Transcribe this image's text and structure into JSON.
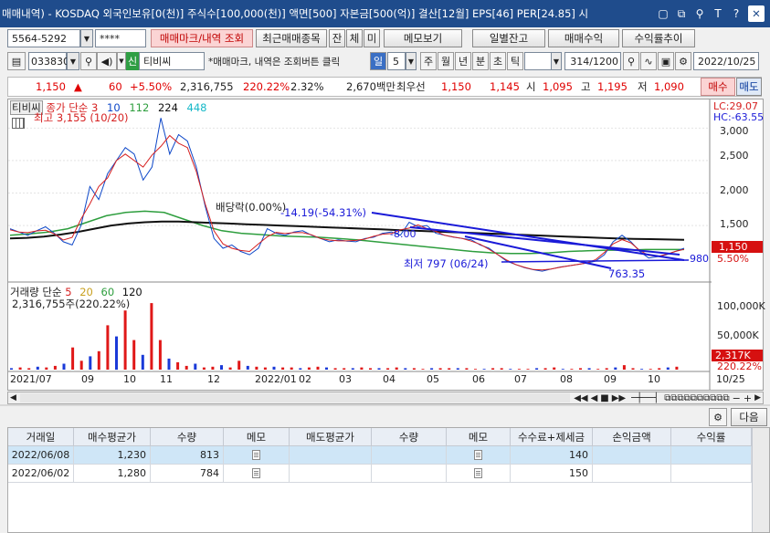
{
  "title": "매매내역) - KOSDAQ 외국인보유[0(천)] 주식수[100,000(천)] 액면[500] 자본금[500(억)] 결산[12월] EPS[46] PER[24.85] 시",
  "title_icons": [
    "▢",
    "⧉",
    "⚲",
    "T",
    "?"
  ],
  "close_label": "✕",
  "account": {
    "number": "5564-5292",
    "password": "****"
  },
  "toolbar1": {
    "memo_trades": "매매마크/내역 조회",
    "recent_items": "최근매매종목",
    "small_buttons": [
      "잔",
      "체",
      "미"
    ],
    "memo_view": "메모보기",
    "daily_balance": "일별잔고",
    "trade_return": "매매수익",
    "return_trend": "수익률추이"
  },
  "toolbar2": {
    "code": "033830",
    "sin_badge": "신",
    "stock_name": "티비씨",
    "hint": "*매매마크, 내역은 조회버튼 클릭",
    "period_label": "일",
    "period_value": "5",
    "periods": [
      "주",
      "월",
      "년",
      "분",
      "초",
      "틱"
    ],
    "count": "314",
    "count_total": "/1200",
    "date": "2022/10/25"
  },
  "quote": {
    "price": "1,150",
    "arrow": "▲",
    "change": "60",
    "change_pct": "+5.50%",
    "volume": "2,316,755",
    "volume_ratio": "220.22%",
    "turnover": "2.32%",
    "amount": "2,670백만",
    "best_ask_label": "최우선",
    "best_ask": "1,150",
    "best_bid": "1,145",
    "open_label": "시",
    "open": "1,095",
    "high_label": "고",
    "high": "1,195",
    "low_label": "저",
    "low": "1,090",
    "buy_label": "매수",
    "sell_label": "매도"
  },
  "chart_data": {
    "type": "line",
    "price_legend": {
      "name": "티비씨",
      "series_label": "종가 단순",
      "periods": [
        "3",
        "10",
        "112",
        "224",
        "448"
      ]
    },
    "annotations": {
      "high": "최고 3,155 (10/20)",
      "dividend": "배당락(0.00%)",
      "trend_pct": "-14.19(-54.31%)",
      "low": "최저 797 (06/24)",
      "trend_low": "763.35",
      "mid_value": "-8.00",
      "level_980": "980",
      "lc": "LC:29.07",
      "hc": "HC:-63.55"
    },
    "y_ticks": [
      "3,000",
      "2,500",
      "2,000",
      "1,500"
    ],
    "current_price": "1,150",
    "current_pct": "5.50%",
    "x_ticks": [
      "2021/07",
      "09",
      "10",
      "11",
      "12",
      "2022/01",
      "02",
      "03",
      "04",
      "05",
      "06",
      "07",
      "08",
      "09",
      "10",
      "10/25"
    ],
    "price": [
      1450,
      1400,
      1350,
      1420,
      1480,
      1380,
      1250,
      1200,
      1500,
      2100,
      1900,
      2300,
      2500,
      2700,
      2600,
      2200,
      2400,
      3155,
      2600,
      2900,
      2800,
      2400,
      1800,
      1300,
      1150,
      1200,
      1100,
      1050,
      1150,
      1450,
      1380,
      1350,
      1400,
      1420,
      1350,
      1300,
      1250,
      1280,
      1260,
      1250,
      1300,
      1320,
      1380,
      1400,
      1350,
      1550,
      1480,
      1500,
      1380,
      1350,
      1320,
      1300,
      1280,
      1200,
      1150,
      1050,
      950,
      900,
      850,
      820,
      797,
      830,
      860,
      880,
      900,
      920,
      950,
      1050,
      1250,
      1350,
      1250,
      1100,
      1000,
      1020,
      1050,
      1100,
      1150
    ],
    "ma_long": [
      1300,
      1310,
      1330,
      1360,
      1400,
      1450,
      1500,
      1530,
      1550,
      1560,
      1560,
      1550,
      1540,
      1530,
      1520,
      1510,
      1500,
      1490,
      1480,
      1470,
      1460,
      1450,
      1440,
      1430,
      1420,
      1410,
      1400,
      1390,
      1380,
      1370,
      1360,
      1350,
      1340,
      1330,
      1320,
      1310,
      1300,
      1295,
      1290,
      1285,
      1280
    ],
    "ma_mid": [
      1350,
      1370,
      1400,
      1450,
      1550,
      1650,
      1700,
      1720,
      1700,
      1600,
      1500,
      1420,
      1380,
      1360,
      1340,
      1330,
      1320,
      1300,
      1280,
      1250,
      1220,
      1190,
      1160,
      1130,
      1100,
      1080,
      1070,
      1070,
      1080,
      1100,
      1110,
      1120,
      1120,
      1130,
      1130,
      1130
    ],
    "volume_legend": {
      "label": "거래량 단순",
      "periods": [
        "5",
        "20",
        "60",
        "120"
      ],
      "current": "2,316,755주(220.22%)"
    },
    "volume_ticks": [
      "100,000K",
      "50,000K"
    ],
    "volume_current": "2,317K",
    "volume_pct": "220.22%",
    "volume": [
      2,
      3,
      2,
      4,
      3,
      5,
      8,
      30,
      12,
      18,
      25,
      60,
      45,
      80,
      40,
      20,
      90,
      40,
      15,
      10,
      5,
      8,
      3,
      4,
      6,
      3,
      12,
      5,
      4,
      3,
      4,
      3,
      3,
      2,
      3,
      4,
      3,
      2,
      2,
      2,
      3,
      2,
      2,
      2,
      3,
      2,
      2,
      1,
      2,
      2,
      2,
      2,
      2,
      1,
      1,
      2,
      2,
      1,
      1,
      1,
      2,
      2,
      3,
      1,
      1,
      2,
      2,
      1,
      2,
      3,
      6,
      2,
      1,
      1,
      2,
      3,
      4
    ]
  },
  "nav": {
    "next_label": "다음"
  },
  "table": {
    "headers": [
      "거래일",
      "매수평균가",
      "수량",
      "메모",
      "매도평균가",
      "수량",
      "메모",
      "수수료+제세금",
      "손익금액",
      "수익률"
    ],
    "rows": [
      {
        "date": "2022/06/08",
        "buy_avg": "1,230",
        "buy_qty": "813",
        "sell_avg": "",
        "sell_qty": "",
        "fee": "140",
        "pnl": "",
        "ret": ""
      },
      {
        "date": "2022/06/02",
        "buy_avg": "1,280",
        "buy_qty": "784",
        "sell_avg": "",
        "sell_qty": "",
        "fee": "150",
        "pnl": "",
        "ret": ""
      }
    ]
  }
}
